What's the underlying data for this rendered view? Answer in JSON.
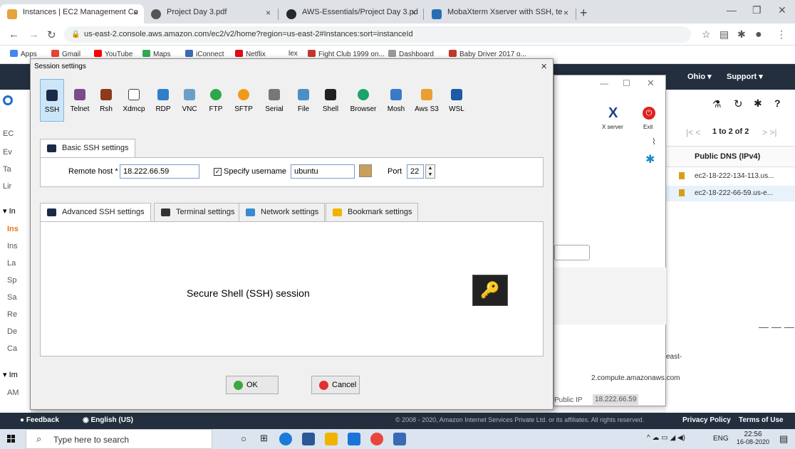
{
  "browser": {
    "tabs": [
      {
        "title": "Instances | EC2 Management Co",
        "close": "×",
        "active": true,
        "color": "#e7a33e"
      },
      {
        "title": "Project Day 3.pdf",
        "close": "×",
        "active": false,
        "color": "#555555"
      },
      {
        "title": "AWS-Essentials/Project Day 3.pd",
        "close": "×",
        "active": false,
        "color": "#24292e"
      },
      {
        "title": "MobaXterm Xserver with SSH, te",
        "close": "×",
        "active": false,
        "color": "#2a6db5"
      }
    ],
    "new_tab": "+",
    "url": "us-east-2.console.aws.amazon.com/ec2/v2/home?region=us-east-2#Instances:sort=instanceId",
    "bookmarks": [
      {
        "label": "Apps",
        "color": "#4285f4"
      },
      {
        "label": "Gmail",
        "color": "#ea4335"
      },
      {
        "label": "YouTube",
        "color": "#ff0000"
      },
      {
        "label": "Maps",
        "color": "#34a853"
      },
      {
        "label": "iConnect",
        "color": "#3b6bb5"
      },
      {
        "label": "Netflix",
        "color": "#e50914"
      },
      {
        "label": "lex",
        "color": "#ffffff"
      },
      {
        "label": "Fight Club 1999 on...",
        "color": "#c0392b"
      },
      {
        "label": "Dashboard",
        "color": "#999999"
      },
      {
        "label": "Baby Driver 2017 o...",
        "color": "#c0392b"
      }
    ]
  },
  "aws": {
    "region": "Ohio",
    "support": "Support",
    "side": [
      "EC",
      "Ev",
      "Ta",
      "Lir",
      "In",
      "Ins",
      "Ins",
      "La",
      "Sp",
      "Sa",
      "Re",
      "De",
      "Ca",
      "Im",
      "AM"
    ],
    "pagination": "1 to 2 of 2",
    "column": "Public DNS (IPv4)",
    "rows": [
      "ec2-18-222-134-113.us...",
      "ec2-18-222-66-59.us-e..."
    ],
    "detail_dns_1": "east-",
    "detail_dns_2": "2.compute.amazonaws.com",
    "public_ip_label": "Public IP",
    "public_ip": "18.222.66.59",
    "footer": {
      "feedback": "Feedback",
      "language": "English (US)",
      "copyright": "© 2008 - 2020, Amazon Internet Services Private Ltd. or its affiliates. All rights reserved.",
      "privacy": "Privacy Policy",
      "terms": "Terms of Use"
    }
  },
  "moba": {
    "xserver": "X server",
    "exit": "Exit"
  },
  "dialog": {
    "title": "Session settings",
    "close": "×",
    "session_types": [
      {
        "label": "SSH",
        "icon": "ssh-icon",
        "color": "#1a2b4a"
      },
      {
        "label": "Telnet",
        "icon": "telnet-icon",
        "color": "#7b4b8a"
      },
      {
        "label": "Rsh",
        "icon": "rsh-icon",
        "color": "#8b3a1a"
      },
      {
        "label": "Xdmcp",
        "icon": "xdmcp-icon",
        "color": "#444444"
      },
      {
        "label": "RDP",
        "icon": "rdp-icon",
        "color": "#2f80c8"
      },
      {
        "label": "VNC",
        "icon": "vnc-icon",
        "color": "#6aa0c8"
      },
      {
        "label": "FTP",
        "icon": "ftp-icon",
        "color": "#2ea84a"
      },
      {
        "label": "SFTP",
        "icon": "sftp-icon",
        "color": "#f09a1a"
      },
      {
        "label": "Serial",
        "icon": "serial-icon",
        "color": "#777777"
      },
      {
        "label": "File",
        "icon": "file-icon",
        "color": "#4a90c8"
      },
      {
        "label": "Shell",
        "icon": "shell-icon",
        "color": "#222222"
      },
      {
        "label": "Browser",
        "icon": "browser-icon",
        "color": "#1aa36a"
      },
      {
        "label": "Mosh",
        "icon": "mosh-icon",
        "color": "#3a7ac8"
      },
      {
        "label": "Aws S3",
        "icon": "aws-s3-icon",
        "color": "#e8a030"
      },
      {
        "label": "WSL",
        "icon": "wsl-icon",
        "color": "#1a5aa8"
      }
    ],
    "basic_tab": "Basic SSH settings",
    "remote_host_label": "Remote host *",
    "remote_host": "18.222.66.59",
    "specify_username": "Specify username",
    "username": "ubuntu",
    "port_label": "Port",
    "port": "22",
    "adv_tabs": [
      {
        "label": "Advanced SSH settings",
        "color": "#1a2b4a"
      },
      {
        "label": "Terminal settings",
        "color": "#333333"
      },
      {
        "label": "Network settings",
        "color": "#3a8ad0"
      },
      {
        "label": "Bookmark settings",
        "color": "#f0b400"
      }
    ],
    "session_desc": "Secure Shell (SSH) session",
    "ok": "OK",
    "cancel": "Cancel"
  },
  "taskbar": {
    "search_placeholder": "Type here to search",
    "lang": "ENG",
    "time": "22:56",
    "date": "16-08-2020"
  }
}
